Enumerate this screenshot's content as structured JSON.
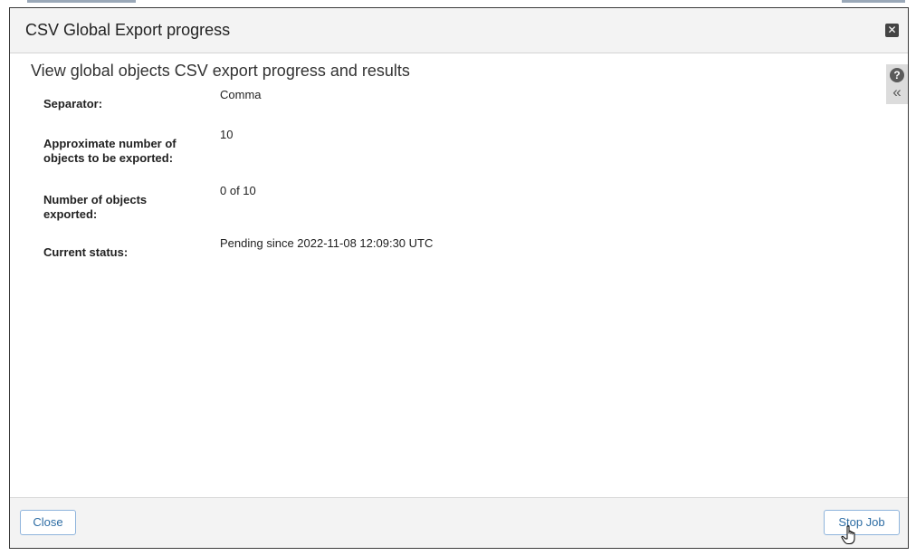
{
  "dialog": {
    "title": "CSV Global Export progress",
    "close_icon": "close-icon",
    "heading": "View global objects CSV export progress and results"
  },
  "side_tools": {
    "help_icon": "help-icon",
    "collapse_icon": "double-chevron-left-icon"
  },
  "fields": {
    "separator": {
      "label": "Separator:",
      "value": "Comma"
    },
    "approximate": {
      "label_line1": "Approximate number of",
      "label_line2": "objects to be exported:",
      "value": "10"
    },
    "exported": {
      "label_line1": "Number of objects",
      "label_line2": "exported:",
      "value": "0 of 10"
    },
    "status": {
      "label": "Current status:",
      "value": "Pending since 2022-11-08 12:09:30 UTC"
    }
  },
  "footer": {
    "close_label": "Close",
    "stop_label": "Stop Job"
  },
  "colors": {
    "button_text": "#2e6da4",
    "button_border": "#8fb4dc",
    "titlebar_bg": "#f3f3f3"
  }
}
